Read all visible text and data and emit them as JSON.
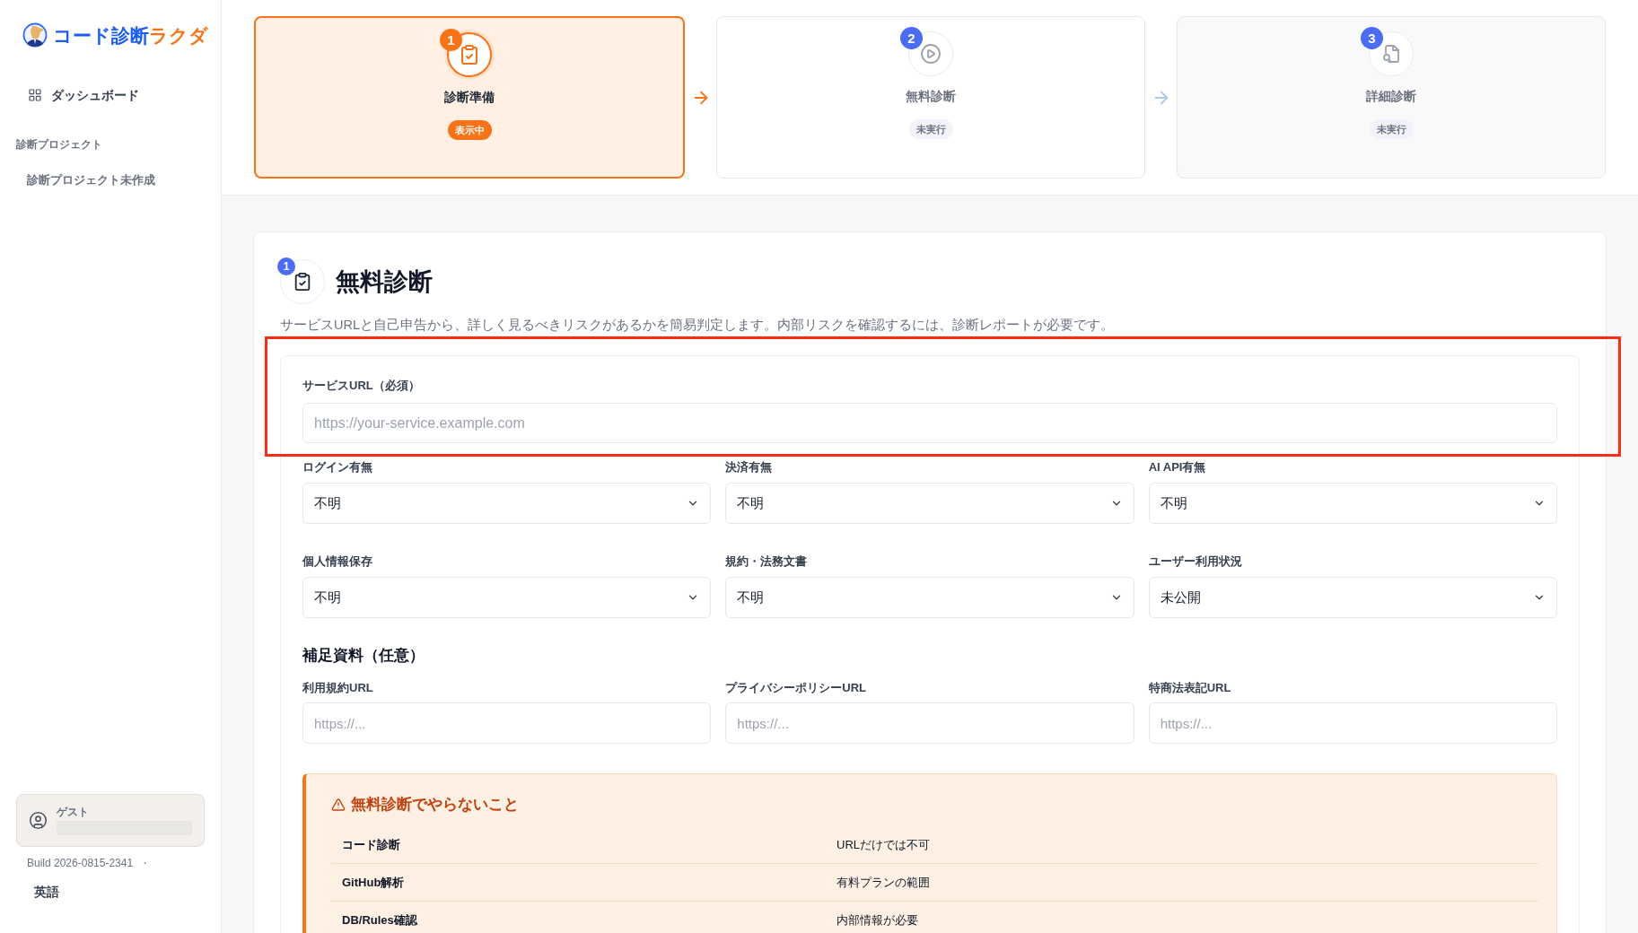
{
  "sidebar": {
    "logo": {
      "primary": "コード診断",
      "accent": "ラクダ"
    },
    "nav": [
      {
        "label": "ダッシュボード",
        "selected": false
      }
    ],
    "section_label": "診断プロジェクト",
    "empty_text": "診断プロジェクト未作成",
    "user": {
      "role": "ゲスト"
    },
    "build": "Build 2026-0815-2341",
    "separator": "・",
    "language": "英語"
  },
  "steps": [
    {
      "number": "1",
      "title": "診断準備",
      "status": "表示中",
      "selected": true
    },
    {
      "number": "2",
      "title": "無料診断",
      "status": "未実行",
      "selected": false
    },
    {
      "number": "3",
      "title": "詳細診断",
      "status": "未実行",
      "selected": false
    }
  ],
  "form": {
    "badge": "1",
    "title": "無料診断",
    "description": "サービスURLと自己申告から、詳しく見るべきリスクがあるかを簡易判定します。内部リスクを確認するには、診断レポートが必要です。",
    "url_field": {
      "label": "サービスURL（必須）",
      "placeholder": "https://your-service.example.com",
      "highlighted": true
    },
    "selects": [
      {
        "label": "ログイン有無",
        "value": "不明"
      },
      {
        "label": "決済有無",
        "value": "不明"
      },
      {
        "label": "AI API有無",
        "value": "不明"
      },
      {
        "label": "個人情報保存",
        "value": "不明"
      },
      {
        "label": "規約・法務文書",
        "value": "不明"
      },
      {
        "label": "ユーザー利用状況",
        "value": "未公開"
      }
    ],
    "supplement": {
      "title": "補足資料（任意）",
      "fields": [
        {
          "label": "利用規約URL",
          "placeholder": "https://..."
        },
        {
          "label": "プライバシーポリシーURL",
          "placeholder": "https://..."
        },
        {
          "label": "特商法表記URL",
          "placeholder": "https://..."
        }
      ]
    },
    "notice": {
      "title": "無料診断でやらないこと",
      "rows": [
        {
          "item": "コード診断",
          "reason": "URLだけでは不可"
        },
        {
          "item": "GitHub解析",
          "reason": "有料プランの範囲"
        },
        {
          "item": "DB/Rules確認",
          "reason": "内部情報が必要"
        }
      ]
    }
  }
}
